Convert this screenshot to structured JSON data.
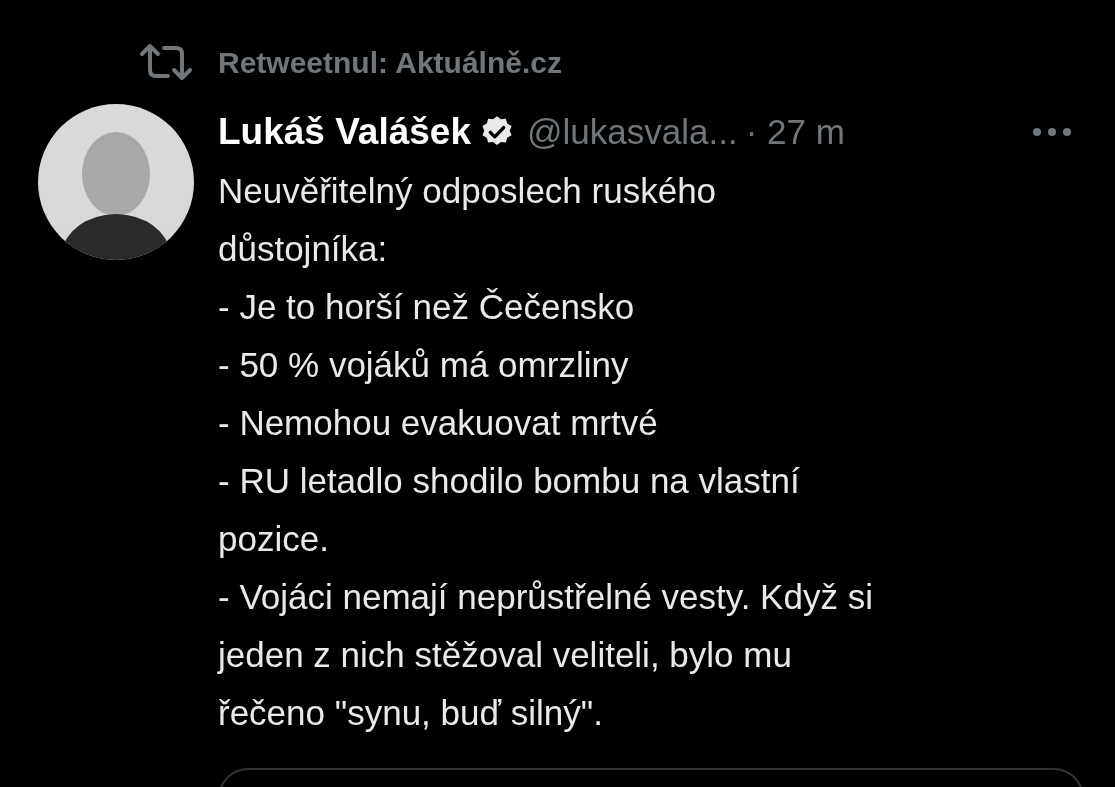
{
  "retweet": {
    "text": "Retweetnul: Aktuálně.cz"
  },
  "tweet": {
    "name": "Lukáš Valášek",
    "verified": true,
    "handle": "@lukasvala...",
    "time": "· 27 m",
    "text_lines": [
      "Neuvěřitelný odposlech ruského",
      "důstojníka:",
      "- Je to horší než Čečensko",
      "- 50 % vojáků má omrzliny",
      "- Nemohou evakuovat mrtvé",
      "- RU letadlo shodilo bombu na vlastní",
      "pozice.",
      "- Vojáci nemají neprůstřelné vesty. Když si",
      "jeden z nich stěžoval veliteli, bylo mu",
      "řečeno \"synu, buď silný\"."
    ]
  }
}
